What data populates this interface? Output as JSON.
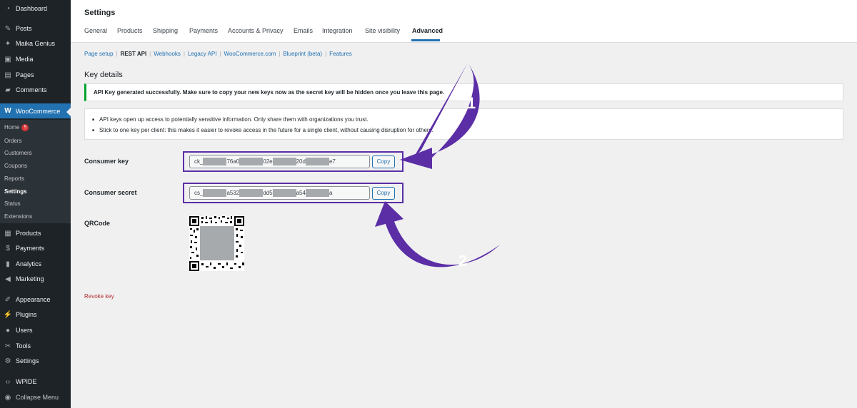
{
  "sidebar": {
    "items": [
      {
        "label": "Dashboard",
        "icon": "dashboard-icon"
      },
      {
        "label": "Posts",
        "icon": "pin-icon"
      },
      {
        "label": "Maika Genius",
        "icon": "sparkle-icon"
      },
      {
        "label": "Media",
        "icon": "media-icon"
      },
      {
        "label": "Pages",
        "icon": "pages-icon"
      },
      {
        "label": "Comments",
        "icon": "comment-icon"
      },
      {
        "label": "WooCommerce",
        "icon": "woo-icon"
      },
      {
        "label": "Products",
        "icon": "box-icon"
      },
      {
        "label": "Payments",
        "icon": "dollar-icon"
      },
      {
        "label": "Analytics",
        "icon": "chart-icon"
      },
      {
        "label": "Marketing",
        "icon": "megaphone-icon"
      },
      {
        "label": "Appearance",
        "icon": "brush-icon"
      },
      {
        "label": "Plugins",
        "icon": "plug-icon"
      },
      {
        "label": "Users",
        "icon": "user-icon"
      },
      {
        "label": "Tools",
        "icon": "wrench-icon"
      },
      {
        "label": "Settings",
        "icon": "gear-icon"
      },
      {
        "label": "WPIDE",
        "icon": "code-icon"
      },
      {
        "label": "Collapse Menu",
        "icon": "collapse-icon"
      }
    ],
    "woo_submenu": [
      "Home",
      "Orders",
      "Customers",
      "Coupons",
      "Reports",
      "Settings",
      "Status",
      "Extensions"
    ],
    "home_badge": "5"
  },
  "header": {
    "title": "Settings",
    "tabs": [
      "General",
      "Products",
      "Shipping",
      "Payments",
      "Accounts & Privacy",
      "Emails",
      "Integration",
      "Site visibility",
      "Advanced"
    ],
    "active_tab": "Advanced"
  },
  "subnav": {
    "items": [
      "Page setup",
      "REST API",
      "Webhooks",
      "Legacy API",
      "WooCommerce.com",
      "Blueprint (beta)",
      "Features"
    ],
    "current": "REST API"
  },
  "main": {
    "heading": "Key details",
    "success_notice": "API Key generated successfully. Make sure to copy your new keys now as the secret key will be hidden once you leave this page.",
    "info_notice": [
      "API keys open up access to potentially sensitive information. Only share them with organizations you trust.",
      "Stick to one key per client: this makes it easier to revoke access in the future for a single client, without causing disruption for others."
    ],
    "consumer_key_label": "Consumer key",
    "consumer_key_parts": [
      "ck_",
      "76a0",
      "02e",
      "20d",
      "e7"
    ],
    "consumer_secret_label": "Consumer secret",
    "consumer_secret_parts": [
      "cs_",
      "a532",
      "dd5",
      "a54",
      "a"
    ],
    "copy_label": "Copy",
    "qrcode_label": "QRCode",
    "revoke_label": "Revoke key"
  },
  "annotations": {
    "marker_1": "1",
    "marker_2": "2",
    "color": "#5b2ea6"
  }
}
